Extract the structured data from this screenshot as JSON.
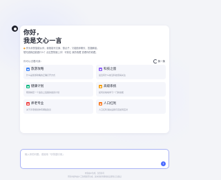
{
  "greeting": {
    "line1": "你好，",
    "line2": "我是文心一言"
  },
  "intro": {
    "line1": "作为你的智能伙伴，我既能写文案、想点子，又能陪你聊天、答疑解惑。",
    "line2": "想知道我还能做什么？点这里快速上手！可前往 我的收藏 查看你的收藏。"
  },
  "section": {
    "title": "你可以试着问我：",
    "refresh_label": "换一换"
  },
  "suggestions": [
    {
      "title": "旅游攻略",
      "icon": "map-icon",
      "color": "#3b82f6",
      "desc": "什么是旅游攻略的正确打开方式"
    },
    {
      "title": "科技之窗",
      "icon": "chip-icon",
      "color": "#8b5cf6",
      "desc": "最近有什么前沿科技值得关注"
    },
    {
      "title": "健康计划",
      "icon": "heart-icon",
      "color": "#10b981",
      "desc": "帮我制定一个适合上班族的健身计划"
    },
    {
      "title": "高级系统",
      "icon": "gear-icon",
      "color": "#f59e0b",
      "desc": "如何系统地学习一门新技能"
    },
    {
      "title": "养老专业",
      "icon": "rocket-icon",
      "color": "#ef4444",
      "desc": "关于养老规划你有哪些建议"
    },
    {
      "title": "人口红利",
      "icon": "people-icon",
      "color": "#f97316",
      "desc": "人口红利消失后我们该如何应对"
    }
  ],
  "input": {
    "placeholder": "输入你的问题，或使用「@快捷引用」"
  },
  "footer": {
    "line1": "内容由AI生成，仅供参考",
    "line2": "所有内容均由人工智能模型生成，其内容的准确性和完整性无法保证"
  }
}
